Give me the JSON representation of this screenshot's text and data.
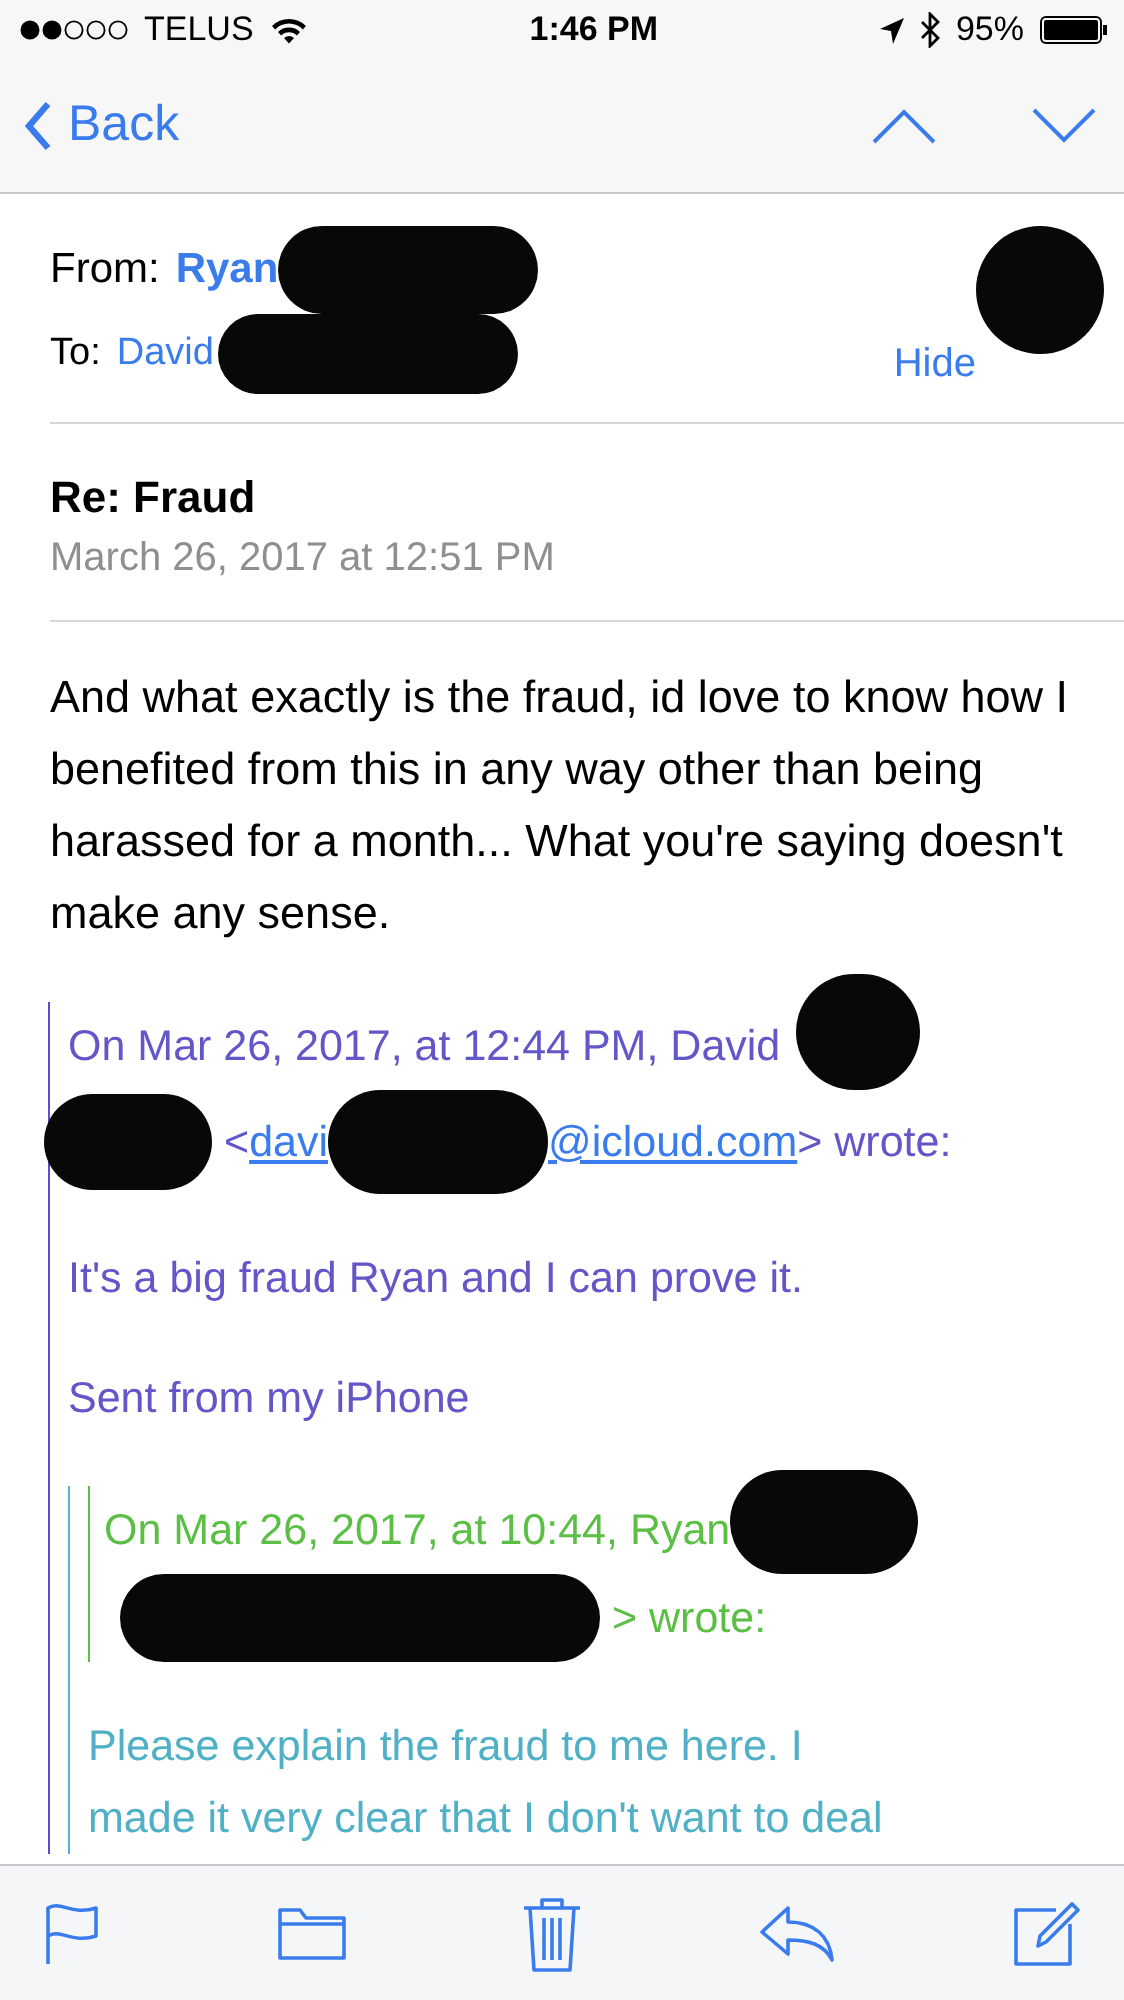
{
  "status_bar": {
    "carrier": "TELUS",
    "time": "1:46 PM",
    "battery": "95%"
  },
  "nav": {
    "back": "Back"
  },
  "header": {
    "from_label": "From:",
    "from_name": "Ryan",
    "to_label": "To:",
    "to_name": "David",
    "hide": "Hide"
  },
  "subject": "Re: Fraud",
  "date": "March 26, 2017 at 12:51 PM",
  "body": "And what exactly is the fraud, id love to know how I benefited from this in any way other than being harassed for a month... What you're saying doesn't make any sense.",
  "quote": {
    "header": "On Mar 26, 2017, at 12:44 PM, David",
    "email_open": "<",
    "email_start": "davi",
    "email_end": "@icloud.com",
    "email_close": "> wrote:",
    "paragraphs": [
      "It's a big fraud Ryan and I can prove it.",
      "Sent from my iPhone"
    ],
    "nested": {
      "header": "On Mar 26, 2017, at 10:44, Ryan",
      "email_close": "> wrote:",
      "lines": [
        "Please explain the fraud to me here.  I",
        "made it very clear that I don't want to deal"
      ]
    }
  }
}
